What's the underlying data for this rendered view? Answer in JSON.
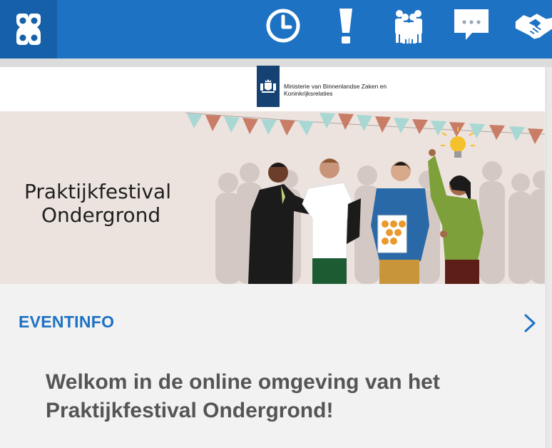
{
  "topbar": {
    "color": "#1e72c3",
    "logo_icon": "app-logo-icon",
    "icons": [
      "clock-icon",
      "exclamation-icon",
      "people-icon",
      "chat-bubble-icon",
      "handshake-icon"
    ]
  },
  "banner": {
    "ministry_name": "Ministerie van Binnenlandse Zaken en Koninkrijksrelaties",
    "title_line1": "Praktijkfestival",
    "title_line2": "Ondergrond"
  },
  "eventinfo": {
    "label": "EVENTINFO",
    "accent_color": "#1e72c3"
  },
  "welcome": {
    "text": "Welkom in de online omgeving van het Praktijkfestival Ondergrond!"
  }
}
